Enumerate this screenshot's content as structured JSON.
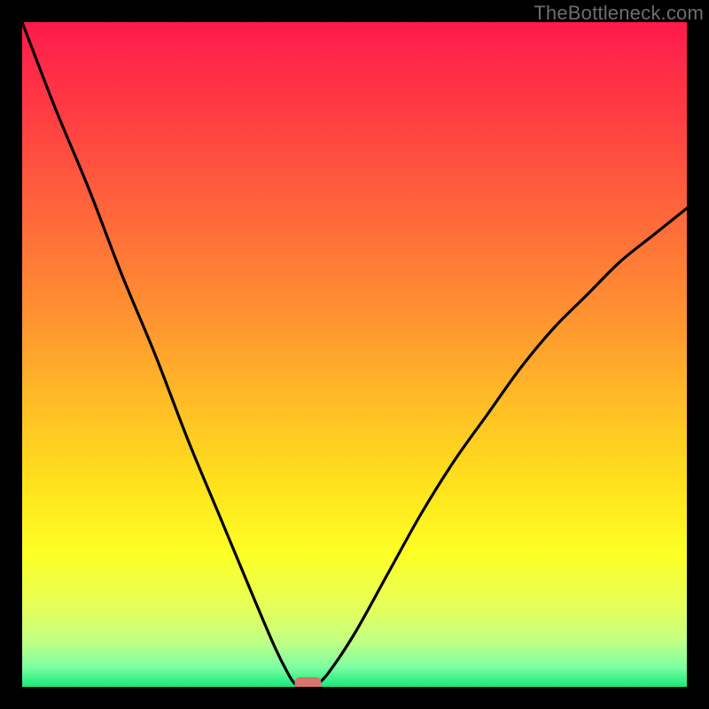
{
  "watermark": "TheBottleneck.com",
  "chart_data": {
    "type": "line",
    "title": "",
    "xlabel": "",
    "ylabel": "",
    "xlim": [
      0,
      100
    ],
    "ylim": [
      0,
      100
    ],
    "grid": false,
    "legend": false,
    "series": [
      {
        "name": "left-branch",
        "x": [
          0,
          5,
          10,
          15,
          20,
          25,
          30,
          35,
          38,
          40,
          41,
          42
        ],
        "y": [
          100,
          87,
          75,
          62,
          50,
          37,
          25,
          13,
          6,
          2,
          0.5,
          0
        ]
      },
      {
        "name": "right-branch",
        "x": [
          44,
          46,
          50,
          55,
          60,
          65,
          70,
          75,
          80,
          85,
          90,
          95,
          100
        ],
        "y": [
          0,
          2,
          8,
          17,
          26,
          34,
          41,
          48,
          54,
          59,
          64,
          68,
          72
        ]
      }
    ],
    "marker": {
      "name": "optimal-point",
      "x": 43,
      "y": 0,
      "color": "#d8736d"
    },
    "background_gradient": {
      "stops": [
        {
          "offset": 0.0,
          "color": "#ff1a4b"
        },
        {
          "offset": 0.15,
          "color": "#ff4042"
        },
        {
          "offset": 0.3,
          "color": "#ff6a3a"
        },
        {
          "offset": 0.45,
          "color": "#ff9530"
        },
        {
          "offset": 0.58,
          "color": "#ffbf26"
        },
        {
          "offset": 0.7,
          "color": "#ffe31c"
        },
        {
          "offset": 0.8,
          "color": "#fdff25"
        },
        {
          "offset": 0.88,
          "color": "#e5ff59"
        },
        {
          "offset": 0.93,
          "color": "#c3ff83"
        },
        {
          "offset": 0.97,
          "color": "#7effa1"
        },
        {
          "offset": 1.0,
          "color": "#18e879"
        }
      ]
    }
  }
}
